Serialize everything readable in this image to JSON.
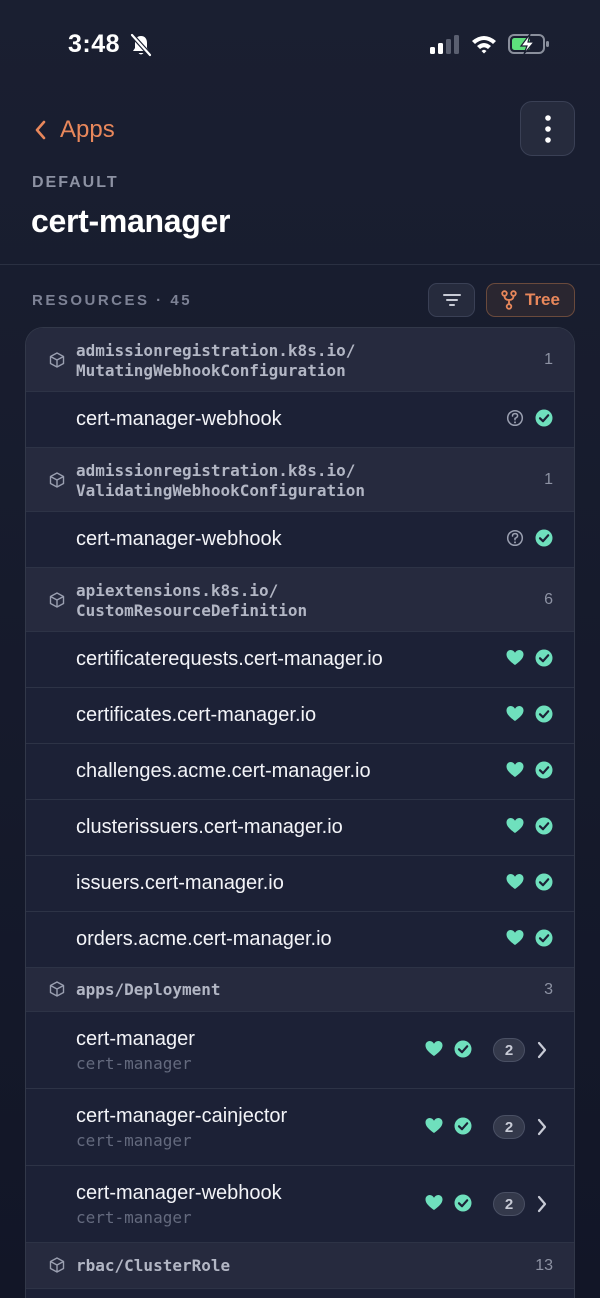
{
  "status_bar": {
    "time": "3:48"
  },
  "nav": {
    "back_label": "Apps"
  },
  "header": {
    "namespace": "DEFAULT",
    "title": "cert-manager"
  },
  "resources": {
    "label": "RESOURCES · 45",
    "tree_label": "Tree"
  },
  "colors": {
    "accent": "#e8875b",
    "healthy": "#6fe0bd",
    "background": "#1a1f31"
  },
  "groups": [
    {
      "line1": "admissionregistration.k8s.io/",
      "line2": "MutatingWebhookConfiguration",
      "count": "1",
      "items": [
        {
          "name": "cert-manager-webhook",
          "health": "unknown",
          "sync": "synced"
        }
      ]
    },
    {
      "line1": "admissionregistration.k8s.io/",
      "line2": "ValidatingWebhookConfiguration",
      "count": "1",
      "items": [
        {
          "name": "cert-manager-webhook",
          "health": "unknown",
          "sync": "synced"
        }
      ]
    },
    {
      "line1": "apiextensions.k8s.io/",
      "line2": "CustomResourceDefinition",
      "count": "6",
      "items": [
        {
          "name": "certificaterequests.cert-manager.io",
          "health": "healthy",
          "sync": "synced"
        },
        {
          "name": "certificates.cert-manager.io",
          "health": "healthy",
          "sync": "synced"
        },
        {
          "name": "challenges.acme.cert-manager.io",
          "health": "healthy",
          "sync": "synced"
        },
        {
          "name": "clusterissuers.cert-manager.io",
          "health": "healthy",
          "sync": "synced"
        },
        {
          "name": "issuers.cert-manager.io",
          "health": "healthy",
          "sync": "synced"
        },
        {
          "name": "orders.acme.cert-manager.io",
          "health": "healthy",
          "sync": "synced"
        }
      ]
    },
    {
      "line1": "apps/Deployment",
      "count": "3",
      "items": [
        {
          "name": "cert-manager",
          "namespace": "cert-manager",
          "health": "healthy",
          "sync": "synced",
          "children": "2"
        },
        {
          "name": "cert-manager-cainjector",
          "namespace": "cert-manager",
          "health": "healthy",
          "sync": "synced",
          "children": "2"
        },
        {
          "name": "cert-manager-webhook",
          "namespace": "cert-manager",
          "health": "healthy",
          "sync": "synced",
          "children": "2"
        }
      ]
    },
    {
      "line1": "rbac/ClusterRole",
      "count": "13",
      "items": []
    }
  ]
}
